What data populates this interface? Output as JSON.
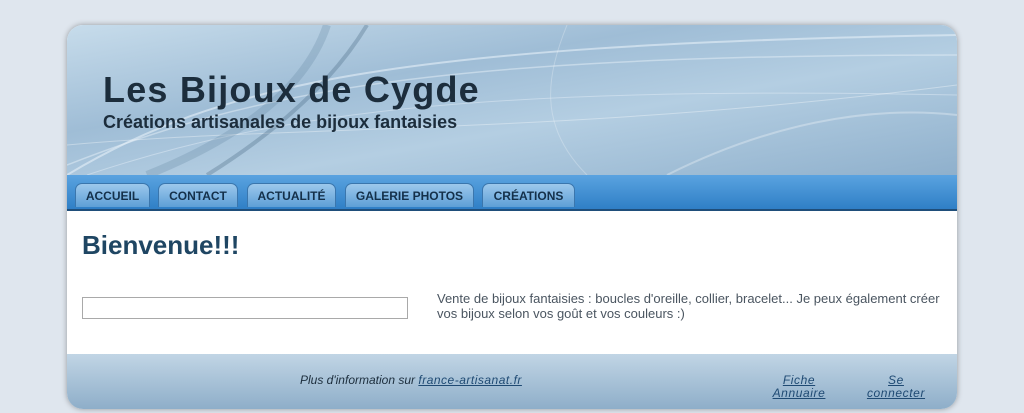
{
  "header": {
    "title": "Les Bijoux de Cygde",
    "subtitle": "Créations artisanales de bijoux fantaisies"
  },
  "nav": {
    "items": [
      {
        "label": "ACCUEIL"
      },
      {
        "label": "CONTACT"
      },
      {
        "label": "ACTUALITÉ"
      },
      {
        "label": "GALERIE PHOTOS"
      },
      {
        "label": "CRÉATIONS"
      }
    ]
  },
  "main": {
    "heading": "Bienvenue!!!",
    "description": "Vente de bijoux fantaisies : boucles d'oreille, collier, bracelet... Je peux également créer vos bijoux selon vos goût et vos couleurs :)"
  },
  "footer": {
    "info_prefix": "Plus d'information sur",
    "info_link": "france-artisanat.fr",
    "fiche_line1": "Fiche",
    "fiche_line2": "Annuaire",
    "connect_line1": "Se",
    "connect_line2": "connecter"
  },
  "colors": {
    "nav_bar": "#2f7fc6",
    "tab": "#9cc8ec",
    "heading": "#1f4663",
    "background": "#dfe6ee"
  }
}
